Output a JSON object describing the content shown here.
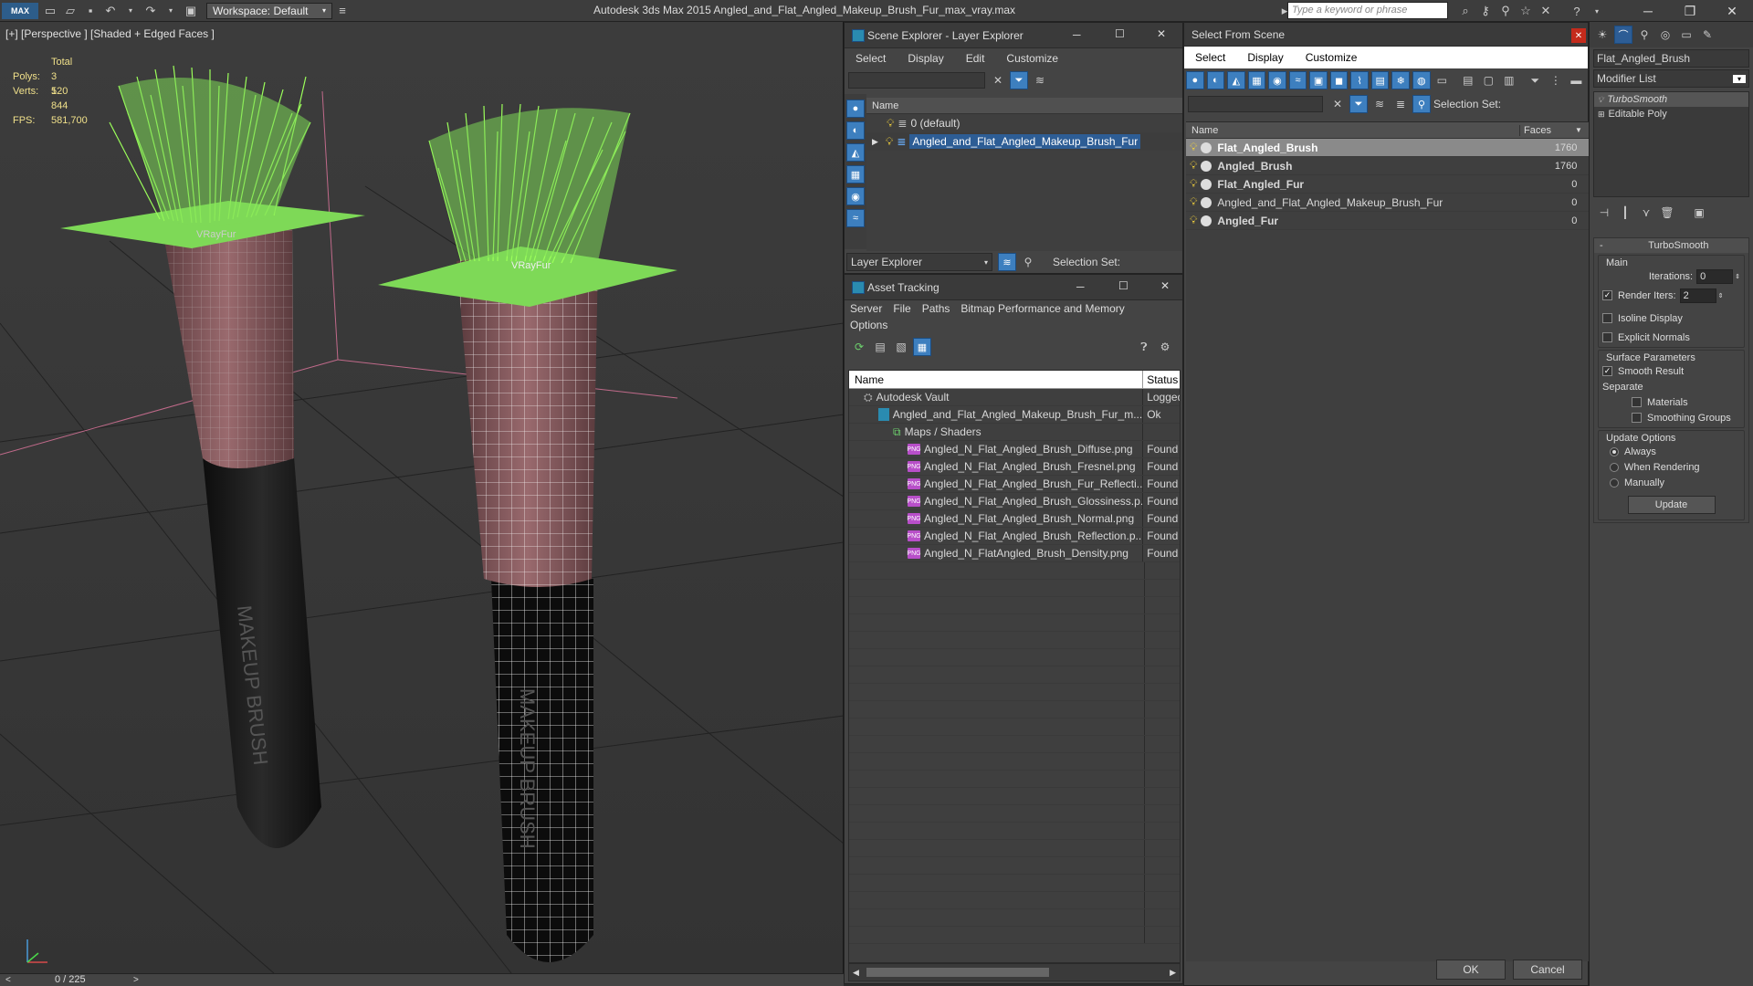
{
  "app": {
    "title": "Autodesk 3ds Max  2015    Angled_and_Flat_Angled_Makeup_Brush_Fur_max_vray.max",
    "workspace": "Workspace: Default",
    "search_placeholder": "Type a keyword or phrase",
    "logo": "MAX"
  },
  "viewport": {
    "label": "[+] [Perspective ] [Shaded + Edged Faces ]",
    "stats": {
      "total_label": "Total",
      "polys_label": "Polys:",
      "polys_value": "3 520",
      "verts_label": "Verts:",
      "verts_value": "1 844",
      "fps_label": "FPS:",
      "fps_value": "581,700"
    },
    "fur_label_1": "VRayFur",
    "fur_label_2": "VRayFur",
    "brush_text": "MAKEUP BRUSH",
    "frame_counter": "0 / 225"
  },
  "scene_explorer": {
    "title": "Scene Explorer - Layer Explorer",
    "menu": [
      "Select",
      "Display",
      "Edit",
      "Customize"
    ],
    "column_name": "Name",
    "rows": [
      {
        "label": "0 (default)"
      },
      {
        "label": "Angled_and_Flat_Angled_Makeup_Brush_Fur"
      }
    ],
    "footer_dropdown": "Layer Explorer",
    "selection_set_label": "Selection Set:"
  },
  "asset_tracking": {
    "title": "Asset Tracking",
    "menu": [
      "Server",
      "File",
      "Paths",
      "Bitmap Performance and Memory"
    ],
    "menu2": [
      "Options"
    ],
    "col_name": "Name",
    "col_status": "Status",
    "rows": [
      {
        "name": "Autodesk Vault",
        "status": "Logged",
        "indent": 0,
        "icon": "vault"
      },
      {
        "name": "Angled_and_Flat_Angled_Makeup_Brush_Fur_m...",
        "status": "Ok",
        "indent": 1,
        "icon": "max"
      },
      {
        "name": "Maps / Shaders",
        "status": "",
        "indent": 2,
        "icon": "maps"
      },
      {
        "name": "Angled_N_Flat_Angled_Brush_Diffuse.png",
        "status": "Found",
        "indent": 3,
        "icon": "png"
      },
      {
        "name": "Angled_N_Flat_Angled_Brush_Fresnel.png",
        "status": "Found",
        "indent": 3,
        "icon": "png"
      },
      {
        "name": "Angled_N_Flat_Angled_Brush_Fur_Reflecti...",
        "status": "Found",
        "indent": 3,
        "icon": "png"
      },
      {
        "name": "Angled_N_Flat_Angled_Brush_Glossiness.p...",
        "status": "Found",
        "indent": 3,
        "icon": "png"
      },
      {
        "name": "Angled_N_Flat_Angled_Brush_Normal.png",
        "status": "Found",
        "indent": 3,
        "icon": "png"
      },
      {
        "name": "Angled_N_Flat_Angled_Brush_Reflection.p...",
        "status": "Found",
        "indent": 3,
        "icon": "png"
      },
      {
        "name": "Angled_N_FlatAngled_Brush_Density.png",
        "status": "Found",
        "indent": 3,
        "icon": "png"
      }
    ]
  },
  "select_from_scene": {
    "title": "Select From Scene",
    "menu": [
      "Select",
      "Display",
      "Customize"
    ],
    "selection_set_label": "Selection Set:",
    "col_name": "Name",
    "col_faces": "Faces",
    "rows": [
      {
        "name": "Flat_Angled_Brush",
        "faces": "1760",
        "bold": true,
        "selected": true
      },
      {
        "name": "Angled_Brush",
        "faces": "1760",
        "bold": true,
        "selected": false
      },
      {
        "name": "Flat_Angled_Fur",
        "faces": "0",
        "bold": true,
        "selected": false
      },
      {
        "name": "Angled_and_Flat_Angled_Makeup_Brush_Fur",
        "faces": "0",
        "bold": false,
        "selected": false
      },
      {
        "name": "Angled_Fur",
        "faces": "0",
        "bold": true,
        "selected": false
      }
    ],
    "ok_label": "OK",
    "cancel_label": "Cancel"
  },
  "command_panel": {
    "object_name": "Flat_Angled_Brush",
    "modifier_list": "Modifier List",
    "stack": [
      "TurboSmooth",
      "Editable Poly"
    ],
    "rollout_title": "TurboSmooth",
    "main_label": "Main",
    "iterations_label": "Iterations:",
    "iterations_value": "0",
    "render_iters_label": "Render Iters:",
    "render_iters_value": "2",
    "isoline_label": "Isoline Display",
    "explicit_normals_label": "Explicit Normals",
    "surface_params_label": "Surface Parameters",
    "smooth_result_label": "Smooth Result",
    "separate_label": "Separate",
    "materials_label": "Materials",
    "smoothing_groups_label": "Smoothing Groups",
    "update_options_label": "Update Options",
    "always_label": "Always",
    "when_rendering_label": "When Rendering",
    "manually_label": "Manually",
    "update_button": "Update"
  },
  "colors": {
    "fur_green": "#7ed957",
    "brush_ferrule": "#8a5a5e",
    "handle": "#1a1a1a",
    "selection_blue": "#3d7fbf",
    "stats_yellow": "#f0e08a"
  }
}
